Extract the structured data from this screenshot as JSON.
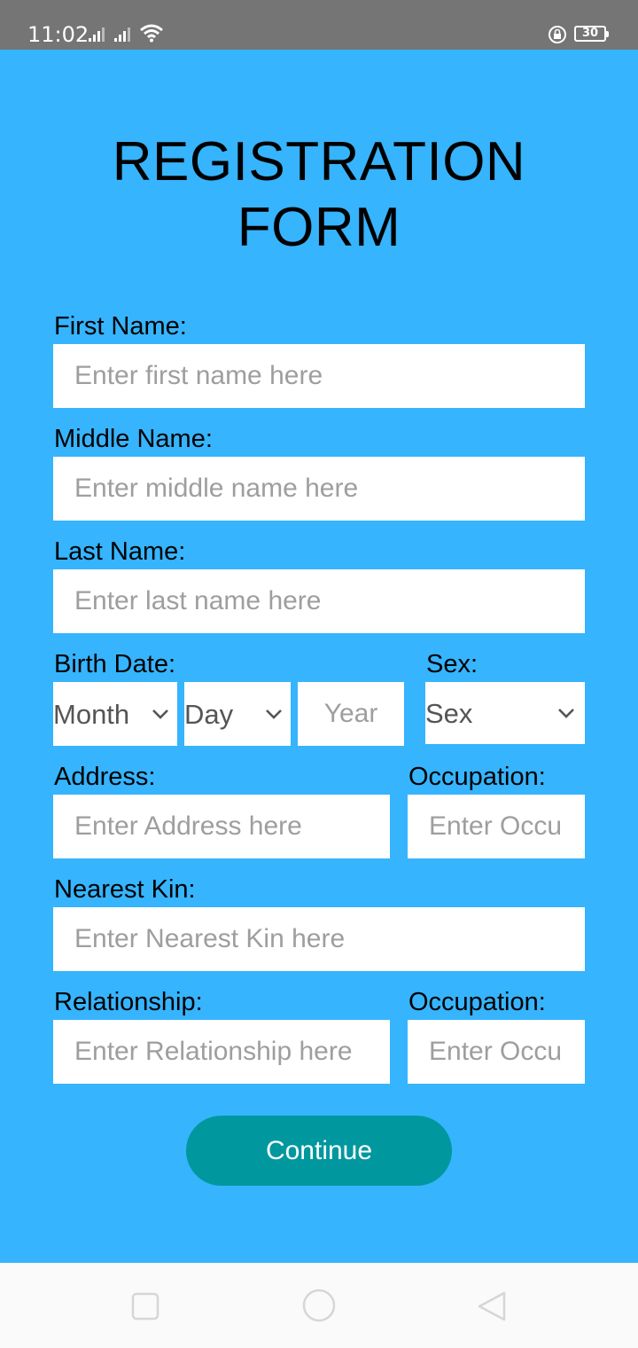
{
  "status_bar": {
    "time": "11:02",
    "battery": "30",
    "icons": [
      "signal-icon",
      "signal-icon",
      "wifi-icon",
      "rotation-lock-icon",
      "battery-icon"
    ]
  },
  "form": {
    "title_line1": "REGISTRATION",
    "title_line2": "FORM",
    "first_name": {
      "label": "First Name:",
      "placeholder": "Enter first name here"
    },
    "middle_name": {
      "label": "Middle Name:",
      "placeholder": "Enter middle name here"
    },
    "last_name": {
      "label": "Last Name:",
      "placeholder": "Enter last name here"
    },
    "birth_date": {
      "label": "Birth Date:",
      "month": "Month",
      "day": "Day",
      "year_placeholder": "Year"
    },
    "sex": {
      "label": "Sex:",
      "value": "Sex"
    },
    "address": {
      "label": "Address:",
      "placeholder": "Enter Address here"
    },
    "occupation": {
      "label": "Occupation:",
      "placeholder": "Enter Occupation here"
    },
    "nearest_kin": {
      "label": "Nearest Kin:",
      "placeholder": "Enter Nearest Kin here"
    },
    "relationship": {
      "label": "Relationship:",
      "placeholder": "Enter Relationship here"
    },
    "kin_occupation": {
      "label": "Occupation:",
      "placeholder": "Enter Occupation here"
    },
    "continue_label": "Continue"
  },
  "colors": {
    "background": "#36b4fd",
    "status_bar": "#757575",
    "button": "#00989e",
    "nav_bar": "#fafafa"
  },
  "nav_bar": {
    "icons": [
      "recent-apps-icon",
      "home-icon",
      "back-icon"
    ]
  }
}
